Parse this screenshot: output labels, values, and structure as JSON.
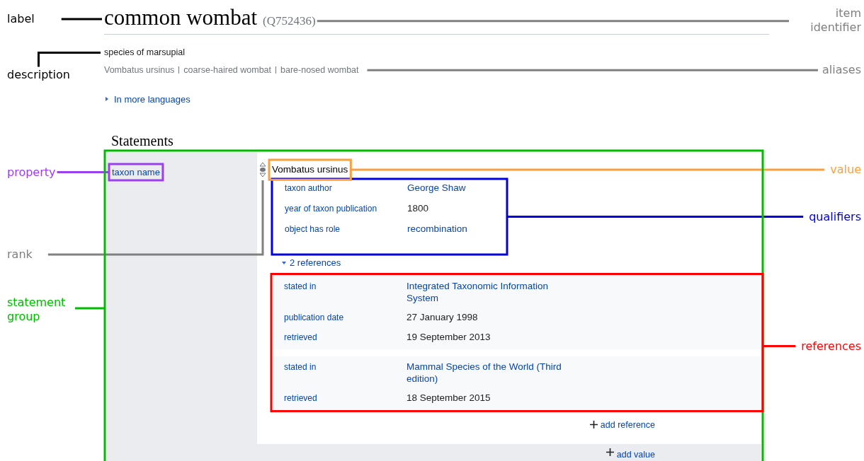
{
  "item": {
    "label": "common wombat",
    "identifier": "(Q752436)",
    "description": "species of marsupial",
    "aliases": [
      "Vombatus ursinus",
      "coarse-haired wombat",
      "bare-nosed wombat"
    ],
    "more_languages": {
      "text": "In more languages",
      "expanded": false
    }
  },
  "statements": {
    "heading": "Statements",
    "group": {
      "property": "taxon name",
      "value": "Vombatus ursinus",
      "qualifiers": [
        {
          "property": "taxon author",
          "value": "George Shaw",
          "kind": "item"
        },
        {
          "property": "year of taxon publication",
          "value": "1800",
          "kind": "literal"
        },
        {
          "property": "object has role",
          "value": "recombination",
          "kind": "item"
        }
      ],
      "references_toggle": {
        "text": "2 references",
        "expanded": true
      },
      "references": [
        [
          {
            "property": "stated in",
            "value": "Integrated Taxonomic Information System",
            "kind": "item"
          },
          {
            "property": "publication date",
            "value": "27 January 1998",
            "kind": "literal"
          },
          {
            "property": "retrieved",
            "value": "19 September 2013",
            "kind": "literal"
          }
        ],
        [
          {
            "property": "stated in",
            "value": "Mammal Species of the World (Third edition)",
            "kind": "item"
          },
          {
            "property": "retrieved",
            "value": "18 September 2015",
            "kind": "literal"
          }
        ]
      ],
      "add_reference": "add reference",
      "add_value": "add value"
    }
  },
  "annotations": [
    {
      "label": "label",
      "kind": "label",
      "color": "#000000"
    },
    {
      "label": "item identifier",
      "kind": "identifier",
      "color": "#808080"
    },
    {
      "label": "description",
      "kind": "description",
      "color": "#000000"
    },
    {
      "label": "aliases",
      "kind": "aliases",
      "color": "#808080"
    },
    {
      "label": "property",
      "kind": "property",
      "color": "#9b3ff0"
    },
    {
      "label": "value",
      "kind": "value",
      "color": "#f9a03f"
    },
    {
      "label": "qualifiers",
      "kind": "qualifiers",
      "color": "#0000e0"
    },
    {
      "label": "rank",
      "kind": "rank",
      "color": "#808080"
    },
    {
      "label": "statement group",
      "kind": "group",
      "color": "#00bb00"
    },
    {
      "label": "references",
      "kind": "references",
      "color": "#ff0000"
    }
  ]
}
